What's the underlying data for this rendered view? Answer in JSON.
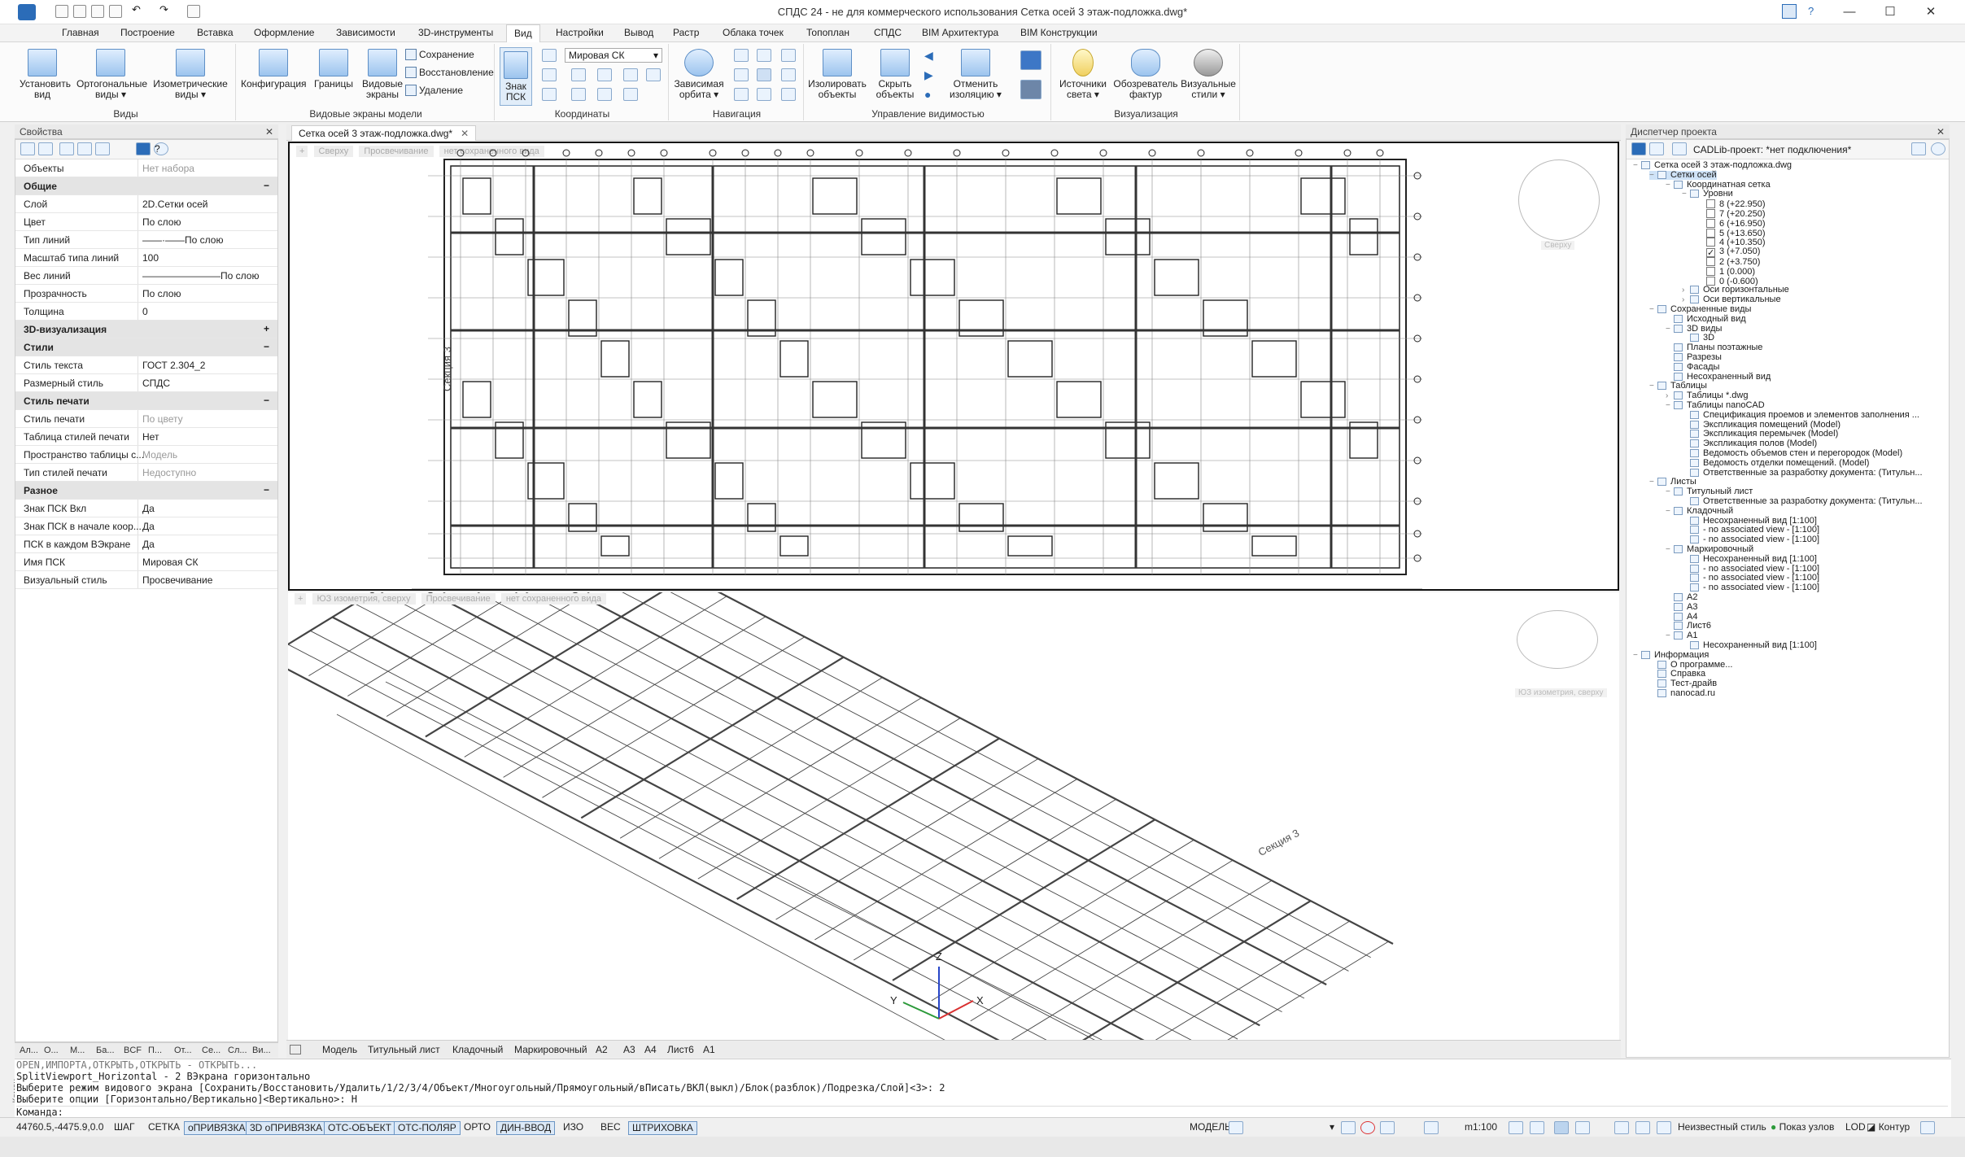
{
  "app": {
    "title": "СПДС 24 - не для коммерческого использования Сетка осей 3 этаж-подложка.dwg*",
    "help": "?"
  },
  "tabs": [
    "Главная",
    "Построение",
    "Вставка",
    "Оформление",
    "Зависимости",
    "3D-инструменты",
    "Вид",
    "Настройки",
    "Вывод",
    "Растр",
    "Облака точек",
    "Топоплан",
    "СПДС",
    "BIM Архитектура",
    "BIM Конструкции"
  ],
  "active_tab": "Вид",
  "ribbon": {
    "views": {
      "label": "Виды",
      "btn1": "Установить вид",
      "btn2": "Ортогональные виды",
      "btn3": "Изометрические виды"
    },
    "vports": {
      "label": "Видовые экраны модели",
      "btn1": "Конфигурация",
      "btn2": "Границы",
      "btn3": "Видовые экраны",
      "s1": "Сохранение",
      "s2": "Восстановление",
      "s3": "Удаление"
    },
    "coords": {
      "label": "Координаты",
      "btn1": "Знак ПСК",
      "select": "Мировая СК"
    },
    "nav": {
      "label": "Навигация",
      "btn1": "Зависимая орбита"
    },
    "visibility": {
      "label": "Управление видимостью",
      "btn1": "Изолировать объекты",
      "btn2": "Скрыть объекты",
      "btn3": "Отменить изоляцию"
    },
    "visual": {
      "label": "Визуализация",
      "btn1": "Источники света",
      "btn2": "Обозреватель фактур",
      "btn3": "Визуальные стили"
    }
  },
  "props": {
    "header": "Свойства",
    "rows": [
      {
        "k": "Объекты",
        "v": "Нет набора",
        "dim": true
      },
      {
        "cat": "Общие",
        "sym": "−"
      },
      {
        "k": "Слой",
        "v": "2D.Сетки осей"
      },
      {
        "k": "Цвет",
        "v": "По слою"
      },
      {
        "k": "Тип линий",
        "v": "——·——По слою"
      },
      {
        "k": "Масштаб типа линий",
        "v": "100"
      },
      {
        "k": "Вес линий",
        "v": "————————По слою"
      },
      {
        "k": "Прозрачность",
        "v": "По слою"
      },
      {
        "k": "Толщина",
        "v": "0"
      },
      {
        "cat": "3D-визуализация",
        "sym": "+"
      },
      {
        "cat": "Стили",
        "sym": "−"
      },
      {
        "k": "Стиль текста",
        "v": "ГОСТ 2.304_2"
      },
      {
        "k": "Размерный стиль",
        "v": "СПДС"
      },
      {
        "cat": "Стиль печати",
        "sym": "−"
      },
      {
        "k": "Стиль печати",
        "v": "По цвету",
        "dim": true
      },
      {
        "k": "Таблица стилей печати",
        "v": "Нет"
      },
      {
        "k": "Пространство таблицы с...",
        "v": "Модель",
        "dim": true
      },
      {
        "k": "Тип стилей печати",
        "v": "Недоступно",
        "dim": true
      },
      {
        "cat": "Разное",
        "sym": "−"
      },
      {
        "k": "Знак ПСК Вкл",
        "v": "Да"
      },
      {
        "k": "Знак ПСК в начале коор...",
        "v": "Да"
      },
      {
        "k": "ПСК в каждом ВЭкране",
        "v": "Да"
      },
      {
        "k": "Имя ПСК",
        "v": "Мировая СК"
      },
      {
        "k": "Визуальный стиль",
        "v": "Просвечивание"
      }
    ]
  },
  "left_tabs": [
    "Ал...",
    "О...",
    "М...",
    "Ба...",
    "BCF",
    "П...",
    "От...",
    "Се...",
    "Сл...",
    "Ви..."
  ],
  "drawing": {
    "tab": "Сетка осей 3 этаж-подложка.dwg*",
    "top_vp": {
      "l1": "Сверху",
      "l2": "Просвечивание",
      "l3": "нет сохраненного вида",
      "cube": "Сверху"
    },
    "bottom_vp": {
      "l1": "ЮЗ изометрия, сверху",
      "l2": "Просвечивание",
      "l3": "нет сохраненного вида",
      "cube": "ЮЗ изометрия, сверху"
    },
    "section_label": "Секция 3",
    "axes": {
      "x": "X",
      "y": "Y",
      "z": "Z"
    }
  },
  "sheets": [
    "Модель",
    "Титульный лист",
    "Кладочный",
    "Маркировочный",
    "A2",
    "A3",
    "A4",
    "Лист6",
    "A1"
  ],
  "pm": {
    "header": "Диспетчер проекта",
    "project": "CADLib-проект: *нет подключения*",
    "items": [
      {
        "t": "Сетка осей 3 этаж-подложка.dwg",
        "lvl": 0,
        "ex": "−"
      },
      {
        "t": "Сетки осей",
        "lvl": 1,
        "ex": "−",
        "sel": true
      },
      {
        "t": "Координатная сетка",
        "lvl": 2,
        "ex": "−"
      },
      {
        "t": "Уровни",
        "lvl": 3,
        "ex": "−"
      },
      {
        "t": "8 (+22.950)",
        "lvl": 4,
        "cb": true
      },
      {
        "t": "7 (+20.250)",
        "lvl": 4,
        "cb": true
      },
      {
        "t": "6 (+16.950)",
        "lvl": 4,
        "cb": true
      },
      {
        "t": "5 (+13.650)",
        "lvl": 4,
        "cb": true
      },
      {
        "t": "4 (+10.350)",
        "lvl": 4,
        "cb": true
      },
      {
        "t": "3 (+7.050)",
        "lvl": 4,
        "cb": true,
        "chk": true
      },
      {
        "t": "2 (+3.750)",
        "lvl": 4,
        "cb": true
      },
      {
        "t": "1 (0.000)",
        "lvl": 4,
        "cb": true
      },
      {
        "t": "0 (-0.600)",
        "lvl": 4,
        "cb": true
      },
      {
        "t": "Оси горизонтальные",
        "lvl": 3,
        "ex": "›"
      },
      {
        "t": "Оси вертикальные",
        "lvl": 3,
        "ex": "›"
      },
      {
        "t": "Сохраненные виды",
        "lvl": 1,
        "ex": "−"
      },
      {
        "t": "Исходный вид",
        "lvl": 2
      },
      {
        "t": "3D виды",
        "lvl": 2,
        "ex": "−"
      },
      {
        "t": "3D",
        "lvl": 3
      },
      {
        "t": "Планы поэтажные",
        "lvl": 2
      },
      {
        "t": "Разрезы",
        "lvl": 2
      },
      {
        "t": "Фасады",
        "lvl": 2
      },
      {
        "t": "Несохраненный вид",
        "lvl": 2
      },
      {
        "t": "Таблицы",
        "lvl": 1,
        "ex": "−"
      },
      {
        "t": "Таблицы *.dwg",
        "lvl": 2,
        "ex": "›"
      },
      {
        "t": "Таблицы nanoCAD",
        "lvl": 2,
        "ex": "−"
      },
      {
        "t": "Спецификация проемов и элементов заполнения ...",
        "lvl": 3
      },
      {
        "t": "Экспликация помещений (Model)",
        "lvl": 3
      },
      {
        "t": "Экспликация перемычек (Model)",
        "lvl": 3
      },
      {
        "t": "Экспликация полов (Model)",
        "lvl": 3
      },
      {
        "t": "Ведомость объемов стен и перегородок (Model)",
        "lvl": 3
      },
      {
        "t": "Ведомость отделки помещений. (Model)",
        "lvl": 3
      },
      {
        "t": "Ответственные за разработку документа: (Титульн...",
        "lvl": 3
      },
      {
        "t": "Листы",
        "lvl": 1,
        "ex": "−"
      },
      {
        "t": "Титульный лист",
        "lvl": 2,
        "ex": "−"
      },
      {
        "t": "Ответственные за разработку документа: (Титульн...",
        "lvl": 3
      },
      {
        "t": "Кладочный",
        "lvl": 2,
        "ex": "−"
      },
      {
        "t": "Несохраненный вид [1:100]",
        "lvl": 3
      },
      {
        "t": "- no associated view - [1:100]",
        "lvl": 3
      },
      {
        "t": "- no associated view - [1:100]",
        "lvl": 3
      },
      {
        "t": "Маркировочный",
        "lvl": 2,
        "ex": "−"
      },
      {
        "t": "Несохраненный вид [1:100]",
        "lvl": 3
      },
      {
        "t": "- no associated view - [1:100]",
        "lvl": 3
      },
      {
        "t": "- no associated view - [1:100]",
        "lvl": 3
      },
      {
        "t": "- no associated view - [1:100]",
        "lvl": 3
      },
      {
        "t": "A2",
        "lvl": 2
      },
      {
        "t": "A3",
        "lvl": 2
      },
      {
        "t": "A4",
        "lvl": 2
      },
      {
        "t": "Лист6",
        "lvl": 2
      },
      {
        "t": "A1",
        "lvl": 2,
        "ex": "−"
      },
      {
        "t": "Несохраненный вид [1:100]",
        "lvl": 3
      },
      {
        "t": "Информация",
        "lvl": 0,
        "ex": "−"
      },
      {
        "t": "О программе...",
        "lvl": 1
      },
      {
        "t": "Справка",
        "lvl": 1
      },
      {
        "t": "Тест-драйв",
        "lvl": 1
      },
      {
        "t": "nanocad.ru",
        "lvl": 1
      }
    ]
  },
  "cmd": {
    "side": "Коман",
    "l1": "OPEN,ИМПОРТА,ОТКРЫТЬ,ОТКРЫТЬ - ОТКРЫТЬ...",
    "l2": "SplitViewport_Horizontal - 2 ВЭкрана горизонтально",
    "l3": "Выберите режим видового экрана [Сохранить/Восстановить/Удалить/1/2/3/4/Объект/Многоугольный/Прямоугольный/вПисать/ВКЛ(выкл)/Блок(разблок)/Подрезка/Слой]<3>: 2",
    "l4": "Выберите опции [Горизонтально/Вертикально]<Вертикально>: Н",
    "prompt": "Команда:"
  },
  "status": {
    "coords": "44760.5,-4475.9,0.0",
    "toggles": [
      {
        "t": "ШАГ",
        "on": false
      },
      {
        "t": "СЕТКА",
        "on": false
      },
      {
        "t": "оПРИВЯЗКА",
        "on": true
      },
      {
        "t": "3D оПРИВЯЗКА",
        "on": true
      },
      {
        "t": "ОТС-ОБЪЕКТ",
        "on": true
      },
      {
        "t": "ОТС-ПОЛЯР",
        "on": true
      },
      {
        "t": "ОРТО",
        "on": false
      },
      {
        "t": "ДИН-ВВОД",
        "on": true
      },
      {
        "t": "ИЗО",
        "on": false
      },
      {
        "t": "ВЕС",
        "on": false
      },
      {
        "t": "ШТРИХОВКА",
        "on": true
      }
    ],
    "model": "МОДЕЛЬ",
    "scale": "m1:100",
    "style": "Неизвестный стиль",
    "nodes": "Показ узлов",
    "lod": "LOD",
    "contour": "Контур"
  },
  "colors": {
    "accent": "#2b6cb8",
    "axis_x": "#d93030",
    "axis_y": "#2c9a3a",
    "axis_z": "#2846c8"
  }
}
